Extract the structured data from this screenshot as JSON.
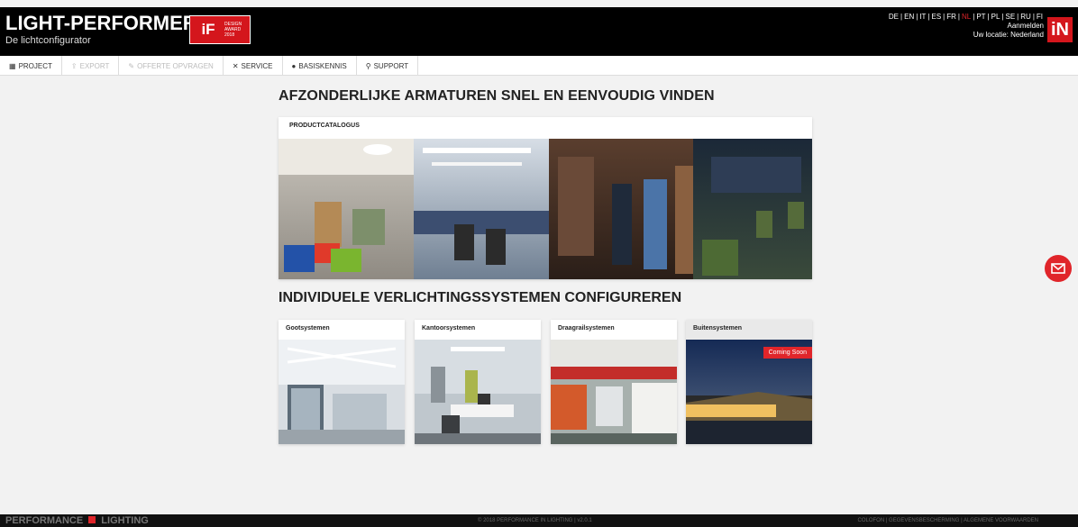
{
  "header": {
    "brand": "LIGHT-PERFORMER",
    "brand_mark": "®",
    "subtitle": "De lichtconfigurator",
    "award": {
      "logo": "iF",
      "line1": "DESIGN",
      "line2": "AWARD",
      "line3": "2018"
    },
    "languages": [
      "DE",
      "EN",
      "IT",
      "ES",
      "FR",
      "NL",
      "PT",
      "PL",
      "SE",
      "RU",
      "FI"
    ],
    "active_language": "NL",
    "login": "Aanmelden",
    "location": "Uw locatie: Nederland",
    "logo": "iN"
  },
  "nav": [
    {
      "label": "PROJECT",
      "icon": "grid-icon",
      "disabled": false
    },
    {
      "label": "EXPORT",
      "icon": "export-icon",
      "disabled": true
    },
    {
      "label": "OFFERTE OPVRAGEN",
      "icon": "quote-icon",
      "disabled": true
    },
    {
      "label": "SERVICE",
      "icon": "tools-icon",
      "disabled": false
    },
    {
      "label": "BASISKENNIS",
      "icon": "info-icon",
      "disabled": false
    },
    {
      "label": "SUPPORT",
      "icon": "location-icon",
      "disabled": false
    }
  ],
  "main": {
    "heading1": "AFZONDERLIJKE ARMATUREN SNEL EN EENVOUDIG VINDEN",
    "catalog_title": "PRODUCTCATALOGUS",
    "heading2": "INDIVIDUELE VERLICHTINGSSYSTEMEN CONFIGUREREN",
    "systems": [
      {
        "title": "Gootsystemen"
      },
      {
        "title": "Kantoorsystemen"
      },
      {
        "title": "Draagrailsystemen"
      },
      {
        "title": "Buitensystemen",
        "badge": "Coming Soon"
      }
    ]
  },
  "footer": {
    "brand_left": "PERFORMANCE",
    "brand_right": "LIGHTING",
    "copyright": "© 2018 PERFORMANCE IN LIGHTING | v2.0.1",
    "links": "COLOFON | GEGEVENSBESCHERMING | ALGEMENE VOORWAARDEN"
  },
  "colors": {
    "accent": "#e0252a",
    "header_bg": "#000000"
  }
}
